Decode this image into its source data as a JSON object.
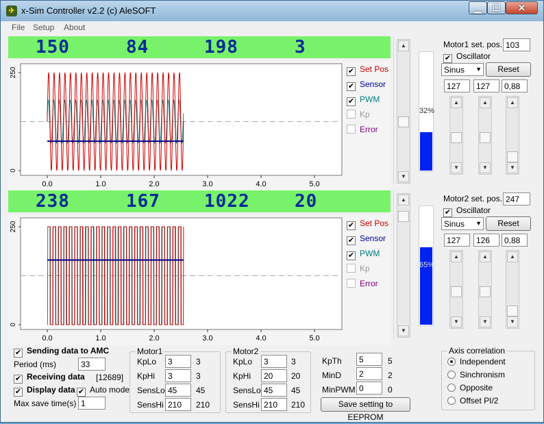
{
  "window": {
    "title": "x-Sim Controller v2.2 (c) AleSOFT",
    "icon": "app-icon"
  },
  "menu": [
    "File",
    "Setup",
    "About"
  ],
  "motors": [
    {
      "numbers": [
        "150",
        "84",
        "198",
        "3"
      ],
      "set_pos_label": "Motor1 set. pos.",
      "set_pos_value": "103",
      "oscillator_label": "Oscillator",
      "wave": "Sinus",
      "reset_label": "Reset",
      "params": [
        "127",
        "127",
        "0,88"
      ],
      "progress_text": "32%",
      "progress_value": 0.32,
      "legend": [
        {
          "label": "Set Pos",
          "checked": true,
          "color": "#cc0000"
        },
        {
          "label": "Sensor",
          "checked": true,
          "color": "#0000a0"
        },
        {
          "label": "PWM",
          "checked": true,
          "color": "#008080"
        },
        {
          "label": "Kp",
          "checked": false,
          "color": "#999999"
        },
        {
          "label": "Error",
          "checked": false,
          "color": "#800080"
        }
      ],
      "chart": {
        "type": "line",
        "x_ticks": [
          "0.0",
          "1.0",
          "2.0",
          "3.0",
          "4.0",
          "5.0"
        ],
        "y_ticks": [
          "250",
          "0"
        ],
        "xlim": [
          0,
          5.5
        ],
        "ylim": [
          0,
          250
        ],
        "sine_cycles": 25,
        "x_end": 2.55,
        "mid_line": 125,
        "sensor_level": 75
      }
    },
    {
      "numbers": [
        "238",
        "167",
        "1022",
        "20"
      ],
      "set_pos_label": "Motor2 set. pos.",
      "set_pos_value": "247",
      "oscillator_label": "Oscillator",
      "wave": "Sinus",
      "reset_label": "Reset",
      "params": [
        "127",
        "126",
        "0,88"
      ],
      "progress_text": "65%",
      "progress_value": 0.65,
      "legend": [
        {
          "label": "Set Pos",
          "checked": true,
          "color": "#cc0000"
        },
        {
          "label": "Sensor",
          "checked": true,
          "color": "#0000a0"
        },
        {
          "label": "PWM",
          "checked": true,
          "color": "#008080"
        },
        {
          "label": "Kp",
          "checked": false,
          "color": "#999999"
        },
        {
          "label": "Error",
          "checked": false,
          "color": "#800080"
        }
      ],
      "chart": {
        "type": "line",
        "x_ticks": [
          "0.0",
          "1.0",
          "2.0",
          "3.0",
          "4.0",
          "5.0"
        ],
        "y_ticks": [
          "250",
          "0"
        ],
        "xlim": [
          0,
          5.5
        ],
        "ylim": [
          0,
          250
        ],
        "square_cycles": 25,
        "x_end": 2.55,
        "mid_line": 125,
        "sensor_level": 165
      }
    }
  ],
  "bottom": {
    "sending_label": "Sending data to AMC",
    "period_label": "Period (ms)",
    "period_value": "33",
    "receiving_label": "Receiving data",
    "receiving_count": "[12689]",
    "display_label": "Display data",
    "auto_mode_label": "Auto mode",
    "max_save_label": "Max save time(s)",
    "max_save_value": "1"
  },
  "motor1_group": {
    "title": "Motor1",
    "rows": [
      {
        "label": "KpLo",
        "value": "3",
        "readout": "3"
      },
      {
        "label": "KpHi",
        "value": "3",
        "readout": "3"
      },
      {
        "label": "SensLo",
        "value": "45",
        "readout": "45"
      },
      {
        "label": "SensHi",
        "value": "210",
        "readout": "210"
      }
    ]
  },
  "motor2_group": {
    "title": "Motor2",
    "rows": [
      {
        "label": "KpLo",
        "value": "3",
        "readout": "3"
      },
      {
        "label": "KpHi",
        "value": "20",
        "readout": "20"
      },
      {
        "label": "SensLo",
        "value": "45",
        "readout": "45"
      },
      {
        "label": "SensHi",
        "value": "210",
        "readout": "210"
      }
    ]
  },
  "global_params": [
    {
      "label": "KpTh",
      "value": "5",
      "readout": "5"
    },
    {
      "label": "MinD",
      "value": "2",
      "readout": "2"
    },
    {
      "label": "MinPWM",
      "value": "0",
      "readout": "0"
    }
  ],
  "eeprom_button": "Save setting to EEPROM",
  "axis_correlation": {
    "title": "Axis correlation",
    "options": [
      "Independent",
      "Sinchronism",
      "Opposite",
      "Offset PI/2"
    ],
    "selected": 0
  }
}
